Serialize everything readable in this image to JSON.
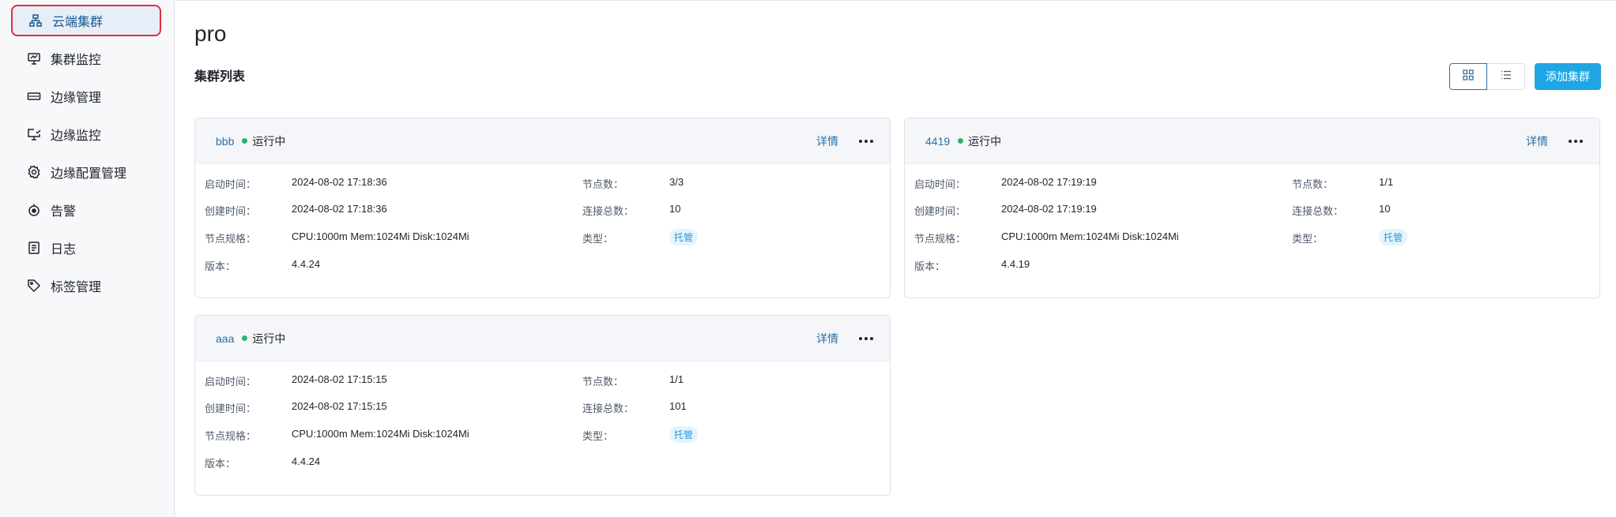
{
  "sidebar": {
    "items": [
      {
        "label": "云端集群",
        "icon": "cluster-icon",
        "active": true
      },
      {
        "label": "集群监控",
        "icon": "monitor-icon"
      },
      {
        "label": "边缘管理",
        "icon": "edge-device-icon"
      },
      {
        "label": "边缘监控",
        "icon": "edge-monitor-icon"
      },
      {
        "label": "边缘配置管理",
        "icon": "gear-icon"
      },
      {
        "label": "告警",
        "icon": "alarm-icon"
      },
      {
        "label": "日志",
        "icon": "log-icon"
      },
      {
        "label": "标签管理",
        "icon": "tag-icon"
      }
    ]
  },
  "page": {
    "title": "pro",
    "section_title": "集群列表",
    "add_button": "添加集群",
    "view_grid_icon": "grid-view-icon",
    "view_list_icon": "list-view-icon"
  },
  "labels": {
    "start_time": "启动时间：",
    "create_time": "创建时间：",
    "node_spec": "节点规格：",
    "version": "版本：",
    "node_count": "节点数：",
    "connections": "连接总数：",
    "type": "类型：",
    "detail": "详情"
  },
  "clusters": [
    {
      "name": "bbb",
      "status": "运行中",
      "start_time": "2024-08-02 17:18:36",
      "create_time": "2024-08-02 17:18:36",
      "node_spec": "CPU:1000m Mem:1024Mi Disk:1024Mi",
      "version": "4.4.24",
      "node_count": "3/3",
      "connections": "10",
      "type": "托管"
    },
    {
      "name": "4419",
      "status": "运行中",
      "start_time": "2024-08-02 17:19:19",
      "create_time": "2024-08-02 17:19:19",
      "node_spec": "CPU:1000m Mem:1024Mi Disk:1024Mi",
      "version": "4.4.19",
      "node_count": "1/1",
      "connections": "10",
      "type": "托管"
    },
    {
      "name": "aaa",
      "status": "运行中",
      "start_time": "2024-08-02 17:15:15",
      "create_time": "2024-08-02 17:15:15",
      "node_spec": "CPU:1000m Mem:1024Mi Disk:1024Mi",
      "version": "4.4.24",
      "node_count": "1/1",
      "connections": "101",
      "type": "托管"
    }
  ],
  "colors": {
    "accent": "#1fa5e3",
    "link": "#2b6fa6",
    "status_running": "#2fb36c",
    "active_outline": "#e02f3f"
  }
}
